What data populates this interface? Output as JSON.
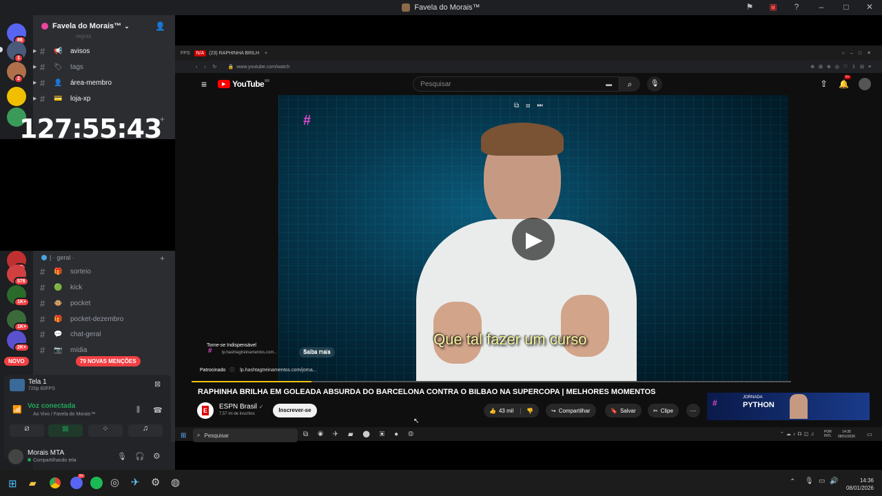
{
  "window": {
    "title": "Favela do Morais™"
  },
  "servers": [
    {
      "badge": "86",
      "color": "#5865f2"
    },
    {
      "badge": "1",
      "color": "#4a5a7a"
    },
    {
      "badge": "2",
      "color": "#b0704a"
    },
    {
      "badge": "",
      "color": "#f0c000"
    },
    {
      "badge": "",
      "color": "#3a9a5a"
    },
    {
      "badge": "15",
      "color": "#c03030"
    },
    {
      "badge": "576",
      "color": "#d04040"
    },
    {
      "badge": "1K+",
      "color": "#2a6a2a"
    },
    {
      "badge": "1K+",
      "color": "#3a6a3a"
    },
    {
      "badge": "2K+",
      "color": "#5a50d0"
    }
  ],
  "sidebar": {
    "server_name": "Favela do Morais™",
    "channels_top": [
      {
        "emoji": "📢",
        "name": "avisos",
        "active": true
      },
      {
        "emoji": "🏷",
        "name": "tags",
        "active": false
      },
      {
        "emoji": "👤",
        "name": "área-membro",
        "active": true
      },
      {
        "emoji": "💳",
        "name": "loja-xp",
        "active": true
      }
    ],
    "category": "| · geral ·",
    "channels_bottom": [
      {
        "emoji": "🎁",
        "name": "sorteio"
      },
      {
        "emoji": "🟢",
        "name": "kick"
      },
      {
        "emoji": "🐵",
        "name": "pocket"
      },
      {
        "emoji": "🎁",
        "name": "pocket-dezembro"
      },
      {
        "emoji": "💬",
        "name": "chat-geral"
      },
      {
        "emoji": "📷",
        "name": "mídia"
      }
    ],
    "clock": "127:55:43",
    "novo": "NOVO",
    "mentions": "79 NOVAS MENÇÕES"
  },
  "stream": {
    "title": "Tela 1",
    "quality": "720p 60FPS"
  },
  "voice": {
    "status": "Voz conectada",
    "location": "Ao Vivo / Favela do Morais™"
  },
  "user": {
    "name": "Morais MTA",
    "status": "Compartilhando tela"
  },
  "browser": {
    "tab_title": "(23) RAPHINHA BRILH",
    "url": "www.youtube.com/watch"
  },
  "youtube": {
    "logo": "YouTube",
    "region": "BR",
    "search_placeholder": "Pesquisar",
    "notif_count": "9+",
    "caption": "Que tal fazer um curso",
    "ad_title": "Torne-se Indispensável",
    "ad_url": "lp.hashtagtreinamentos.com...",
    "ad_cta": "Saiba mais",
    "sponsored": "Patrocinado",
    "sponsored_url": "lp.hashtagtreinamentos.com/jorna...",
    "video_title": "RAPHINHA BRILHA EM GOLEADA ABSURDA DO BARCELONA CONTRA O BILBAO NA SUPERCOPA | MELHORES MOMENTOS",
    "channel": "ESPN Brasil",
    "subs": "7,57 mi de inscritos",
    "subscribe": "Inscrever-se",
    "likes": "43 mil",
    "share": "Compartilhar",
    "save": "Salvar",
    "clip": "Clipe",
    "thumb_text": "PYTHON",
    "thumb_sub": "JORNADA"
  },
  "inner_taskbar": {
    "search": "Pesquisar",
    "lang": "POR INTL",
    "time": "14:35",
    "date": "08/01/2026"
  },
  "taskbar": {
    "time": "14:36",
    "date": "08/01/2026",
    "discord_badge": "9+"
  }
}
